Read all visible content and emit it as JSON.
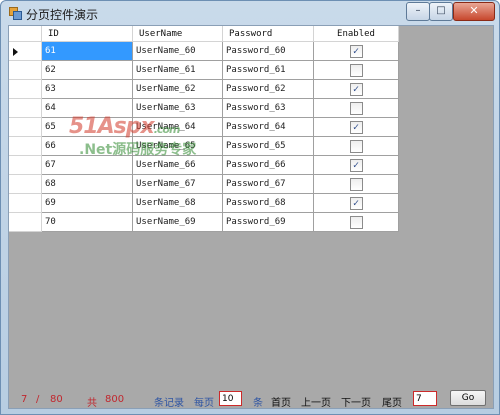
{
  "window": {
    "title": "分页控件演示",
    "controls": {
      "minimize": "–",
      "maximize": "□",
      "close": "✕"
    }
  },
  "grid": {
    "columns": [
      "ID",
      "UserName",
      "Password",
      "Enabled"
    ],
    "selected_row": 0,
    "rows": [
      {
        "id": "61",
        "username": "UserName_60",
        "password": "Password_60",
        "enabled": true
      },
      {
        "id": "62",
        "username": "UserName_61",
        "password": "Password_61",
        "enabled": false
      },
      {
        "id": "63",
        "username": "UserName_62",
        "password": "Password_62",
        "enabled": true
      },
      {
        "id": "64",
        "username": "UserName_63",
        "password": "Password_63",
        "enabled": false
      },
      {
        "id": "65",
        "username": "UserName_64",
        "password": "Password_64",
        "enabled": true
      },
      {
        "id": "66",
        "username": "UserName_65",
        "password": "Password_65",
        "enabled": false
      },
      {
        "id": "67",
        "username": "UserName_66",
        "password": "Password_66",
        "enabled": true
      },
      {
        "id": "68",
        "username": "UserName_67",
        "password": "Password_67",
        "enabled": false
      },
      {
        "id": "69",
        "username": "UserName_68",
        "password": "Password_68",
        "enabled": true
      },
      {
        "id": "70",
        "username": "UserName_69",
        "password": "Password_69",
        "enabled": false
      }
    ]
  },
  "watermark": {
    "brand": "51Aspx",
    "domain": ".com",
    "tagline": ".Net源码服务专家"
  },
  "pager": {
    "current_page": "7",
    "slash": "/",
    "total_pages": "80",
    "total_label": "共",
    "total_count": "800",
    "records_label": "条记录",
    "per_page_label": "每页",
    "page_size": "10",
    "per_page_unit": "条",
    "first": "首页",
    "prev": "上一页",
    "next": "下一页",
    "last": "尾页",
    "goto_value": "7",
    "go": "Go"
  },
  "colors": {
    "selection": "#3399ff",
    "pager_red": "#c0282f",
    "pager_blue": "#2f55a3",
    "client_bg": "#a9a9a9"
  }
}
